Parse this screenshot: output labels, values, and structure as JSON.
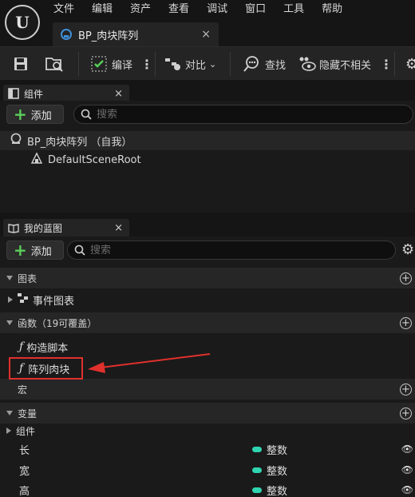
{
  "menu": [
    "文件",
    "编辑",
    "资产",
    "查看",
    "调试",
    "窗口",
    "工具",
    "帮助"
  ],
  "tab": {
    "title": "BP_肉块阵列",
    "close": "×"
  },
  "toolbar": {
    "compile_label": "编译",
    "diff_label": "对比",
    "find_label": "查找",
    "hide_unrelated_label": "隐藏不相关"
  },
  "components_panel": {
    "title": "组件",
    "close": "×",
    "add_label": "添加",
    "search_placeholder": "搜索",
    "tree": [
      {
        "label": "BP_肉块阵列 （自我）"
      },
      {
        "label": "DefaultSceneRoot"
      }
    ]
  },
  "my_blueprint_panel": {
    "title": "我的蓝图",
    "close": "×",
    "add_label": "添加",
    "search_placeholder": "搜索",
    "sections": {
      "graphs": "图表",
      "event_graph": "事件图表",
      "functions": "函数（19可覆盖）",
      "construction_script": "构造脚本",
      "array_meat_block": "阵列肉块",
      "macros": "宏",
      "variables": "变量",
      "components_category": "组件"
    },
    "variables": [
      {
        "name": "长",
        "type": "整数"
      },
      {
        "name": "宽",
        "type": "整数"
      },
      {
        "name": "高",
        "type": "整数"
      }
    ]
  },
  "colors": {
    "background": "#151515",
    "panel": "#242424",
    "integer_type": "#2fd4b0",
    "highlight_annotation": "#e0302c",
    "add_plus": "#5ad05a"
  }
}
